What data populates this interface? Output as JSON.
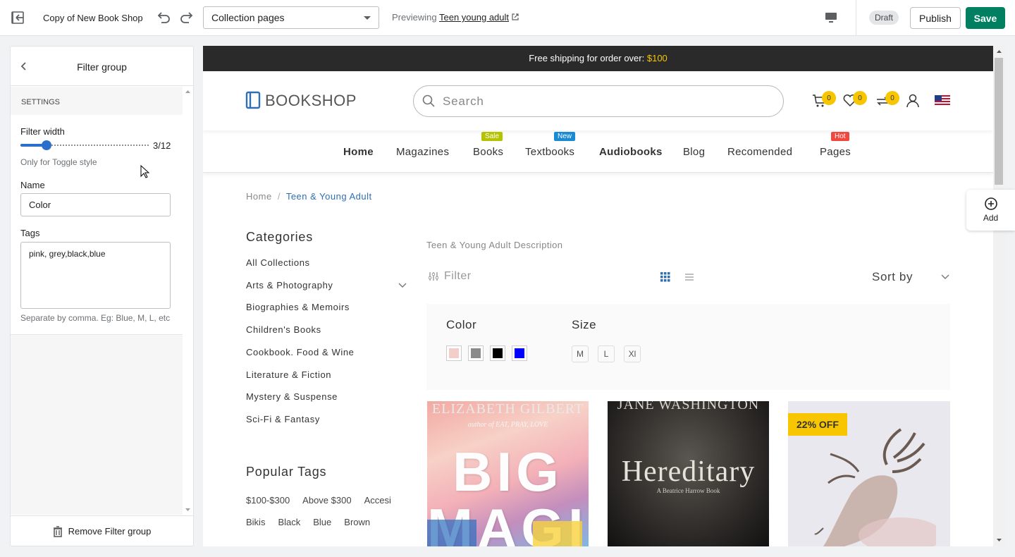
{
  "topbar": {
    "store_name": "Copy of New Book Shop",
    "page_select": "Collection pages",
    "previewing_label": "Previewing",
    "previewing_link": "Teen young adult",
    "status": "Draft",
    "publish": "Publish",
    "save": "Save"
  },
  "panel": {
    "title": "Filter group",
    "section": "SETTINGS",
    "filter_width_label": "Filter width",
    "filter_width_value": "3/12",
    "filter_width_fraction": 0.25,
    "filter_width_help": "Only for Toggle style",
    "name_label": "Name",
    "name_value": "Color",
    "tags_label": "Tags",
    "tags_value": "pink, grey,black,blue",
    "tags_help": "Separate by comma. Eg: Blue, M, L, etc",
    "remove": "Remove Filter group"
  },
  "store": {
    "shipping_text": "Free shipping for order over:",
    "shipping_amount": "$100",
    "logo": "BOOKSHOP",
    "search_placeholder": "Search",
    "counts": {
      "cart": "0",
      "wishlist": "0",
      "compare": "0"
    },
    "nav": [
      {
        "label": "Home",
        "bold": true
      },
      {
        "label": "Magazines"
      },
      {
        "label": "Books",
        "badge": "Sale",
        "badge_color": "#b5c200"
      },
      {
        "label": "Textbooks",
        "badge": "New",
        "badge_color": "#1a8ad4"
      },
      {
        "label": "Audiobooks",
        "bold": true
      },
      {
        "label": "Blog"
      },
      {
        "label": "Recomended"
      },
      {
        "label": "Pages",
        "badge": "Hot",
        "badge_color": "#f0483e"
      }
    ],
    "breadcrumb": {
      "home": "Home",
      "sep": "/",
      "current": "Teen & Young Adult"
    },
    "categories_title": "Categories",
    "categories": [
      "All Collections",
      "Arts & Photography",
      "Biographies & Memoirs",
      "Children's Books",
      "Cookbook. Food & Wine",
      "Literature & Fiction",
      "Mystery & Suspense",
      "Sci-Fi & Fantasy"
    ],
    "popular_tags_title": "Popular Tags",
    "tags_row1": [
      "$100-$300",
      "Above $300",
      "Accesi"
    ],
    "tags_row2": [
      "Bikis",
      "Black",
      "Blue",
      "Brown"
    ],
    "collection_desc": "Teen & Young Adult Description",
    "filter_label": "Filter",
    "sort_label": "Sort by",
    "filter_color_title": "Color",
    "filter_colors": [
      "#f2cdc9",
      "#8a8a8a",
      "#000000",
      "#0000ff"
    ],
    "filter_size_title": "Size",
    "filter_sizes": [
      "M",
      "L",
      "Xl"
    ],
    "products": [
      {
        "author": "ELIZABETH GILBERT",
        "subtitle": "author of EAT, PRAY, LOVE",
        "title": "BIG MAGIC"
      },
      {
        "author": "JANE WASHINGTON",
        "title": "Hereditary",
        "subtitle": "A Beatrice Harrow Book"
      },
      {
        "discount": "22% OFF"
      }
    ]
  },
  "add_widget": "Add"
}
